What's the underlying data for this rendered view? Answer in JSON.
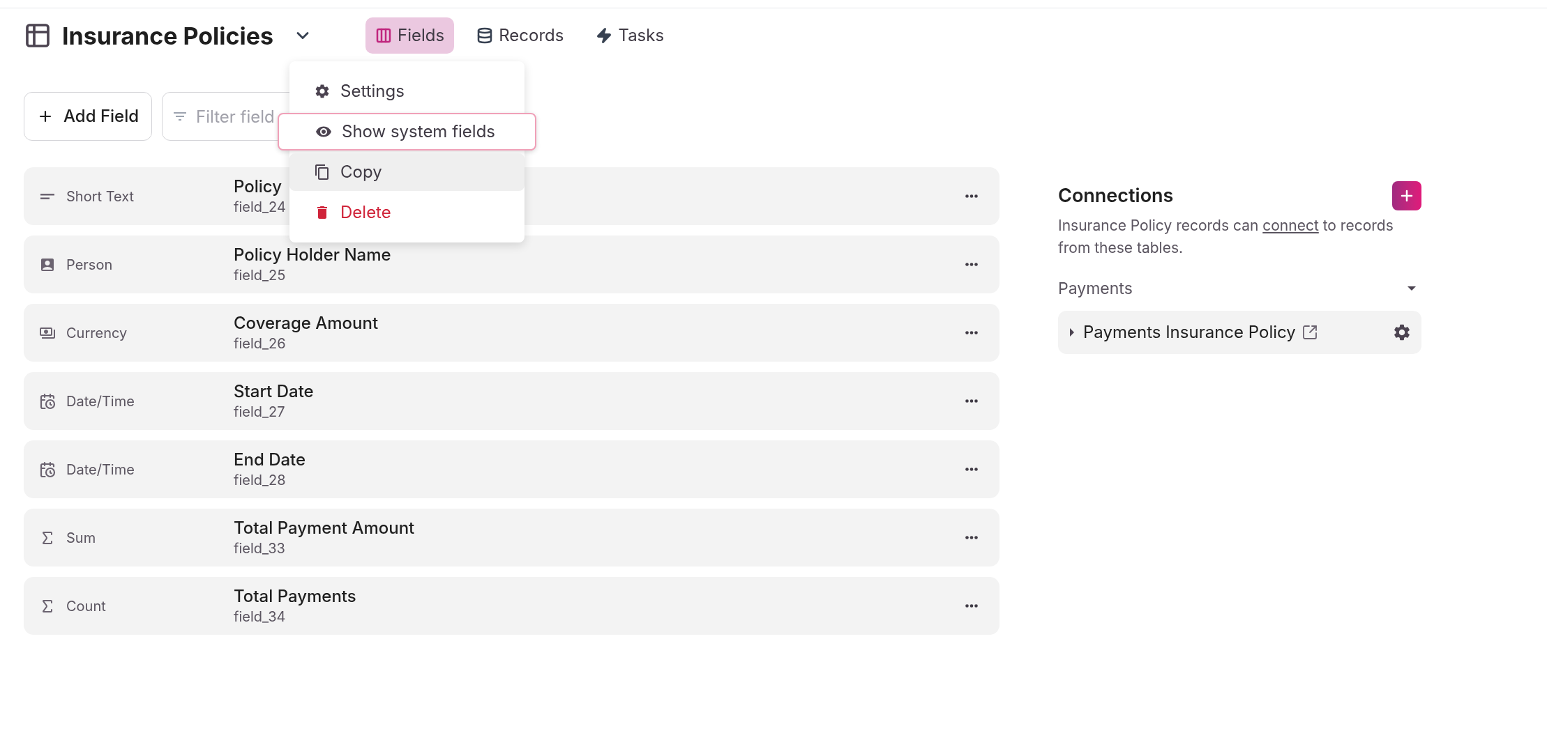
{
  "header": {
    "title": "Insurance Policies"
  },
  "tabs": [
    {
      "label": "Fields",
      "kind": "fields",
      "selected": true
    },
    {
      "label": "Records",
      "kind": "records",
      "selected": false
    },
    {
      "label": "Tasks",
      "kind": "tasks",
      "selected": false
    }
  ],
  "menu": {
    "items": [
      {
        "label": "Settings",
        "kind": "settings",
        "focused": false,
        "hovered": false
      },
      {
        "label": "Show system fields",
        "kind": "show",
        "focused": true,
        "hovered": false
      },
      {
        "label": "Copy",
        "kind": "copy",
        "focused": false,
        "hovered": true
      },
      {
        "label": "Delete",
        "kind": "delete",
        "focused": false,
        "hovered": false
      }
    ]
  },
  "toolbar": {
    "add_button": "Add Field",
    "filter": {
      "placeholder": "Filter field"
    }
  },
  "fields": [
    {
      "kind": "text",
      "type": "Short Text",
      "name": "Policy",
      "id": "field_24"
    },
    {
      "kind": "person",
      "type": "Person",
      "name": "Policy Holder Name",
      "id": "field_25"
    },
    {
      "kind": "currency",
      "type": "Currency",
      "name": "Coverage Amount",
      "id": "field_26"
    },
    {
      "kind": "datetime",
      "type": "Date/Time",
      "name": "Start Date",
      "id": "field_27"
    },
    {
      "kind": "datetime",
      "type": "Date/Time",
      "name": "End Date",
      "id": "field_28"
    },
    {
      "kind": "sum",
      "type": "Sum",
      "name": "Total Payment Amount",
      "id": "field_33"
    },
    {
      "kind": "count",
      "type": "Count",
      "name": "Total Payments",
      "id": "field_34"
    }
  ],
  "connections": {
    "title": "Connections",
    "description_before": "Insurance Policy records can",
    "link": "connect",
    "description_after": "to records from these tables.",
    "groups": [
      {
        "title": "Payments",
        "expanded": true,
        "items": [
          {
            "label": "Payments Insurance Policy",
            "expanded": false
          }
        ]
      }
    ]
  }
}
